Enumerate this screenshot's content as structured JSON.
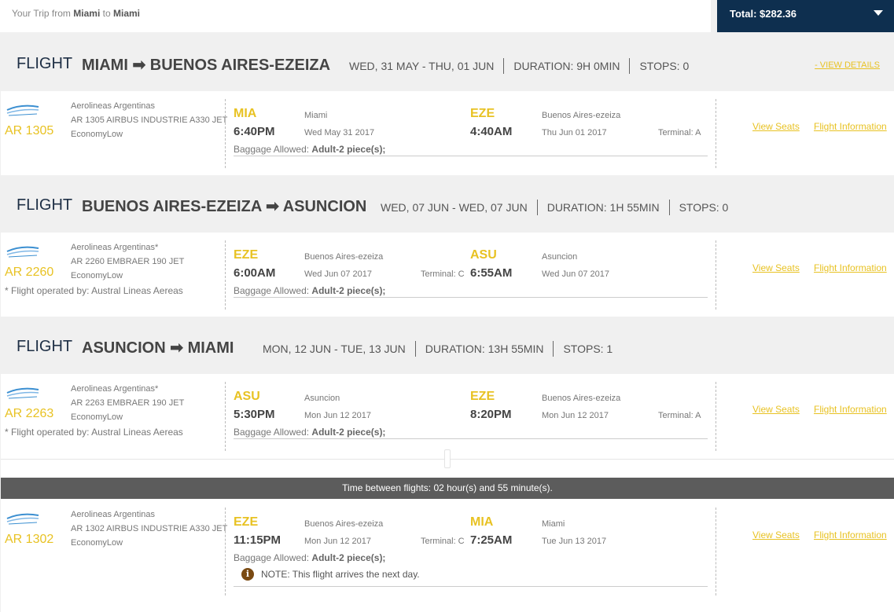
{
  "header": {
    "trip_prefix": "Your Trip from",
    "trip_from": "Miami",
    "trip_to_word": "to",
    "trip_to": "Miami",
    "total": "Total: $282.36"
  },
  "flights": [
    {
      "label": "FLIGHT",
      "from": "MIAMI",
      "to": "BUENOS AIRES-EZEIZA",
      "dates": "WED, 31 MAY - THU, 01 JUN",
      "duration": "DURATION: 9H 0MIN",
      "stops": "STOPS: 0",
      "view_details": "- VIEW DETAILS"
    },
    {
      "label": "FLIGHT",
      "from": "BUENOS AIRES-EZEIZA",
      "to": "ASUNCION",
      "dates": "WED, 07 JUN - WED, 07 JUN",
      "duration": "DURATION: 1H 55MIN",
      "stops": "STOPS: 0"
    },
    {
      "label": "FLIGHT",
      "from": "ASUNCION",
      "to": "MIAMI",
      "dates": "MON, 12 JUN - TUE, 13 JUN",
      "duration": "DURATION: 13H 55MIN",
      "stops": "STOPS: 1"
    }
  ],
  "segments": [
    {
      "flight_number": "AR 1305",
      "airline": "Aerolineas Argentinas",
      "aircraft": "AR 1305 AIRBUS INDUSTRIE A330 JET",
      "cabin": "EconomyLow",
      "dep_code": "MIA",
      "dep_city": "Miami",
      "dep_time": "6:40PM",
      "dep_date": "Wed May 31 2017",
      "dep_terminal": "",
      "arr_code": "EZE",
      "arr_city": "Buenos Aires-ezeiza",
      "arr_time": "4:40AM",
      "arr_date": "Thu Jun 01 2017",
      "arr_terminal": "Terminal: A",
      "baggage_label": "Baggage Allowed:",
      "baggage_value": "Adult-2 piece(s);",
      "view_seats": "View Seats",
      "flight_info": "Flight Information"
    },
    {
      "flight_number": "AR 2260",
      "airline": "Aerolineas Argentinas*",
      "aircraft": "AR 2260 EMBRAER 190 JET",
      "cabin": "EconomyLow",
      "operated": "* Flight operated by: Austral Lineas Aereas",
      "dep_code": "EZE",
      "dep_city": "Buenos Aires-ezeiza",
      "dep_time": "6:00AM",
      "dep_date": "Wed Jun 07 2017",
      "dep_terminal": "Terminal: C",
      "arr_code": "ASU",
      "arr_city": "Asuncion",
      "arr_time": "6:55AM",
      "arr_date": "Wed Jun 07 2017",
      "arr_terminal": "",
      "baggage_label": "Baggage Allowed:",
      "baggage_value": "Adult-2 piece(s);",
      "view_seats": "View Seats",
      "flight_info": "Flight Information"
    },
    {
      "flight_number": "AR 2263",
      "airline": "Aerolineas Argentinas*",
      "aircraft": "AR 2263 EMBRAER 190 JET",
      "cabin": "EconomyLow",
      "operated": "* Flight operated by: Austral Lineas Aereas",
      "dep_code": "ASU",
      "dep_city": "Asuncion",
      "dep_time": "5:30PM",
      "dep_date": "Mon Jun 12 2017",
      "dep_terminal": "",
      "arr_code": "EZE",
      "arr_city": "Buenos Aires-ezeiza",
      "arr_time": "8:20PM",
      "arr_date": "Mon Jun 12 2017",
      "arr_terminal": "Terminal: A",
      "baggage_label": "Baggage Allowed:",
      "baggage_value": "Adult-2 piece(s);",
      "view_seats": "View Seats",
      "flight_info": "Flight Information"
    },
    {
      "flight_number": "AR 1302",
      "airline": "Aerolineas Argentinas",
      "aircraft": "AR 1302 AIRBUS INDUSTRIE A330 JET",
      "cabin": "EconomyLow",
      "dep_code": "EZE",
      "dep_city": "Buenos Aires-ezeiza",
      "dep_time": "11:15PM",
      "dep_date": "Mon Jun 12 2017",
      "dep_terminal": "Terminal: C",
      "arr_code": "MIA",
      "arr_city": "Miami",
      "arr_time": "7:25AM",
      "arr_date": "Tue Jun 13 2017",
      "arr_terminal": "",
      "baggage_label": "Baggage Allowed:",
      "baggage_value": "Adult-2 piece(s);",
      "note": "NOTE: This flight arrives the next day.",
      "view_seats": "View Seats",
      "flight_info": "Flight Information"
    }
  ],
  "connection": {
    "prefix": "Time between flights:",
    "value": "02 hour(s) and 55 minute(s)."
  },
  "colors": {
    "accent": "#e8c223",
    "total_bg": "#0e2f4f",
    "connection_bg": "#5c5c5c"
  }
}
